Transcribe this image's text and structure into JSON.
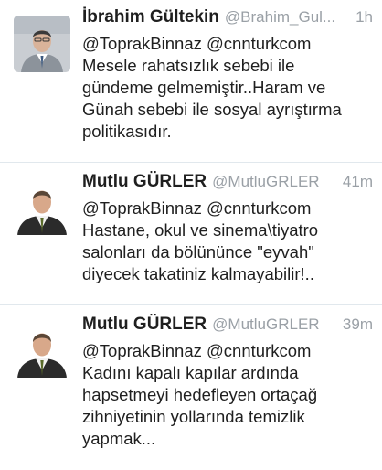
{
  "tweets": [
    {
      "name": "İbrahim Gültekin",
      "handle": "@Brahim_Gul...",
      "time": "1h",
      "avatar_icon": "profile-photo-man-grey-suit",
      "lines": [
        "@ToprakBinnaz @cnnturkcom",
        "Mesele rahatsızlık sebebi ile",
        "gündeme gelmemiştir..Haram ve",
        "Günah sebebi ile sosyal ayrıştırma",
        "politikasıdır."
      ]
    },
    {
      "name": "Mutlu GÜRLER",
      "handle": "@MutluGRLER",
      "time": "41m",
      "avatar_icon": "profile-photo-man-dark-suit",
      "lines": [
        "@ToprakBinnaz @cnnturkcom",
        "Hastane, okul ve sinema\\tiyatro",
        "salonları da bölününce \"eyvah\"",
        "diyecek takatiniz kalmayabilir!.."
      ]
    },
    {
      "name": "Mutlu GÜRLER",
      "handle": "@MutluGRLER",
      "time": "39m",
      "avatar_icon": "profile-photo-man-dark-suit",
      "lines": [
        "@ToprakBinnaz @cnnturkcom",
        "Kadını kapalı kapılar ardında",
        "hapsetmeyi hedefleyen ortaçağ",
        "zihniyetinin yollarında temizlik",
        "yapmak..."
      ]
    }
  ],
  "colors": {
    "name": "#1f1f1f",
    "meta": "#9aa0a6",
    "divider": "#e1e8ed"
  }
}
